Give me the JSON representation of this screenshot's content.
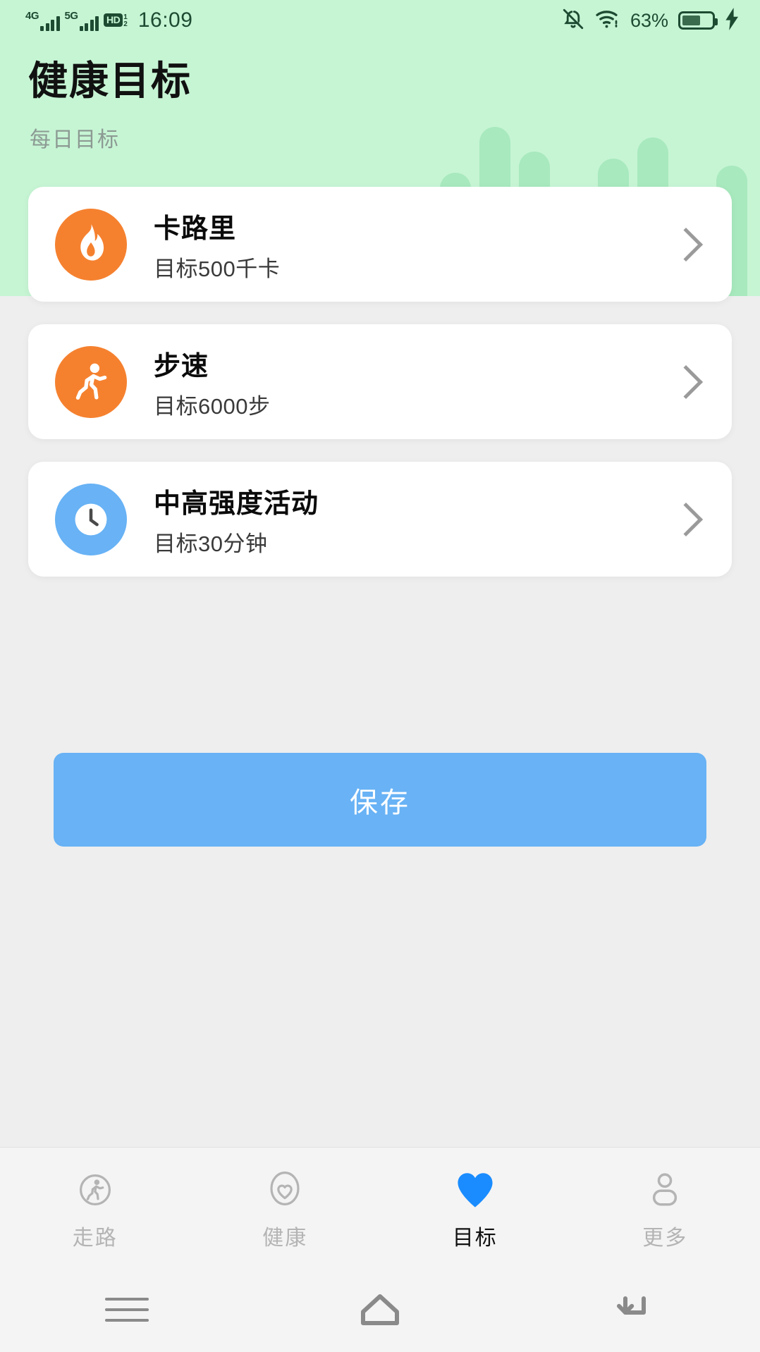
{
  "status_bar": {
    "network_1": "4G",
    "network_2": "5G",
    "hd_label": "HD",
    "hd_sup": "1",
    "hd_sub": "2",
    "time": "16:09",
    "battery_percent": "63%",
    "battery_level": 63,
    "icons": [
      "mute-icon",
      "wifi-icon",
      "battery-icon",
      "charging-bolt-icon"
    ]
  },
  "header": {
    "title": "健康目标",
    "subtitle": "每日目标",
    "background_color": "#C6F5D4"
  },
  "goals": [
    {
      "title": "卡路里",
      "subtitle": "目标500千卡",
      "icon": "flame-icon",
      "icon_color": "#F5812F",
      "value": 500,
      "unit": "千卡"
    },
    {
      "title": "步速",
      "subtitle": "目标6000步",
      "icon": "running-person-icon",
      "icon_color": "#F5812F",
      "value": 6000,
      "unit": "步"
    },
    {
      "title": "中高强度活动",
      "subtitle": "目标30分钟",
      "icon": "clock-icon",
      "icon_color": "#68B2F5",
      "value": 30,
      "unit": "分钟"
    }
  ],
  "actions": {
    "save_label": "保存",
    "save_color": "#68B2F5"
  },
  "tabbar": {
    "active_color": "#1A8CFF",
    "items": [
      {
        "label": "走路",
        "icon": "walking-circle-icon",
        "active": false
      },
      {
        "label": "健康",
        "icon": "heart-outline-icon",
        "active": false
      },
      {
        "label": "目标",
        "icon": "heart-filled-icon",
        "active": true
      },
      {
        "label": "更多",
        "icon": "person-icon",
        "active": false
      }
    ]
  },
  "system_nav": {
    "items": [
      {
        "icon": "recent-apps-icon"
      },
      {
        "icon": "home-icon"
      },
      {
        "icon": "back-icon"
      }
    ]
  }
}
